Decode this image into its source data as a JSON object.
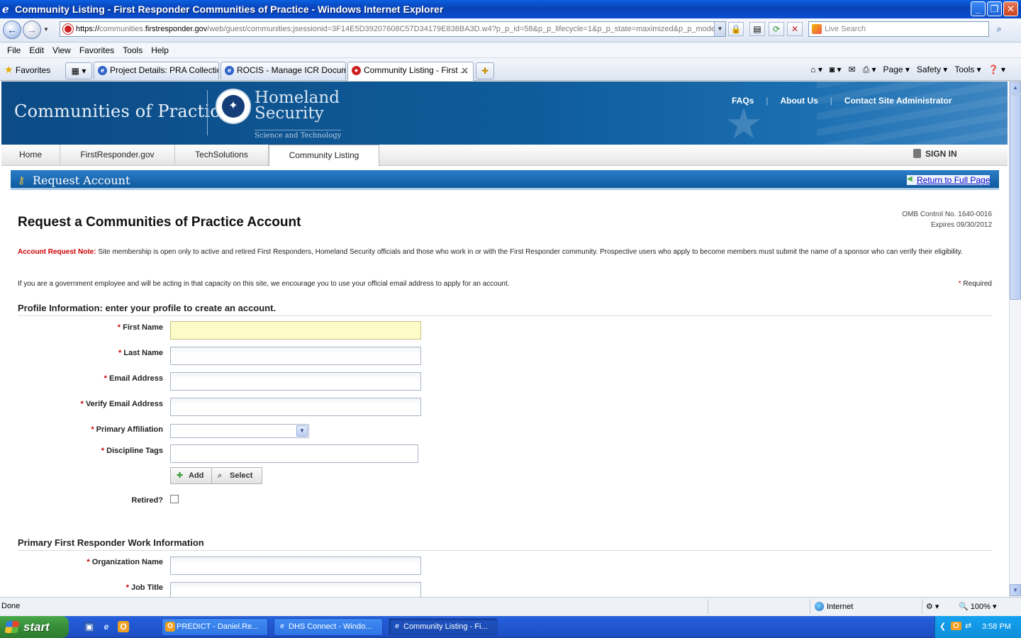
{
  "window": {
    "title": "Community Listing - First Responder Communities of Practice - Windows Internet Explorer",
    "controls": [
      "_",
      "❐",
      "✕"
    ]
  },
  "browser": {
    "url_scheme": "https://",
    "url_host_prefix": "communities.",
    "url_host": "firstresponder.gov",
    "url_path": "/web/guest/communities;jsessionid=3F14E5D39207608C57D34179E838BA3D.w4?p_p_id=58&p_p_lifecycle=1&p_p_state=maximized&p_p_mode=",
    "search_placeholder": "Live Search",
    "menu": [
      "File",
      "Edit",
      "View",
      "Favorites",
      "Tools",
      "Help"
    ],
    "favorites_label": "Favorites",
    "tabs": [
      {
        "label": "Project Details: PRA Collectio...",
        "active": false
      },
      {
        "label": "ROCIS - Manage ICR Docum...",
        "active": false
      },
      {
        "label": "Community Listing - First ...",
        "active": true
      }
    ],
    "command_bar": [
      "Page ▾",
      "Safety ▾",
      "Tools ▾"
    ]
  },
  "site": {
    "header_title": "Communities of Practice",
    "dhs_line1": "Homeland",
    "dhs_line2": "Security",
    "dhs_sub": "Science and Technology",
    "header_links": [
      "FAQs",
      "About Us",
      "Contact Site Administrator"
    ],
    "nav": [
      {
        "label": "Home",
        "active": false
      },
      {
        "label": "FirstResponder.gov",
        "active": false
      },
      {
        "label": "TechSolutions",
        "active": false
      },
      {
        "label": "Community Listing",
        "active": true
      }
    ],
    "sign_in": "SIGN IN"
  },
  "portlet": {
    "title": "Request Account",
    "return_link": "Return to Full Page"
  },
  "form": {
    "heading": "Request a Communities of Practice Account",
    "omb_line1": "OMB Control No. 1640-0016",
    "omb_line2": "Expires 09/30/2012",
    "note_label": "Account Request Note:",
    "note_text": " Site membership is open only to active and retired First Responders, Homeland Security officials and those who work in or with the First Responder community. Prospective users who apply to become members must submit the name of a sponsor who can verify their eligibility.",
    "gov_note": "If you are a government employee and will be acting in that capacity on this site, we encourage you to use your official email address to apply for an account.",
    "required_marker": "*",
    "required_label": "Required",
    "profile_section": "Profile Information: enter your profile to create an account.",
    "labels": {
      "first_name": "First Name",
      "last_name": "Last Name",
      "email": "Email Address",
      "verify_email": "Verify Email Address",
      "affiliation": "Primary Affiliation",
      "discipline": "Discipline Tags",
      "retired": "Retired?",
      "org_name": "Organization Name",
      "job_title": "Job Title"
    },
    "values": {
      "first_name": "",
      "last_name": "",
      "email": "",
      "verify_email": "",
      "affiliation": "",
      "discipline": "",
      "org_name": "",
      "job_title": ""
    },
    "retired_checked": false,
    "add_button": "Add",
    "select_button": "Select",
    "work_section": "Primary First Responder Work Information"
  },
  "status": {
    "left": "Done",
    "zone": "Internet",
    "zoom": "100%"
  },
  "taskbar": {
    "start": "start",
    "buttons": [
      {
        "label": "PREDICT - Daniel.Re...",
        "active": false
      },
      {
        "label": "DHS Connect - Windo...",
        "active": false
      },
      {
        "label": "Community Listing - Fi...",
        "active": true
      }
    ],
    "clock": "3:58 PM"
  }
}
